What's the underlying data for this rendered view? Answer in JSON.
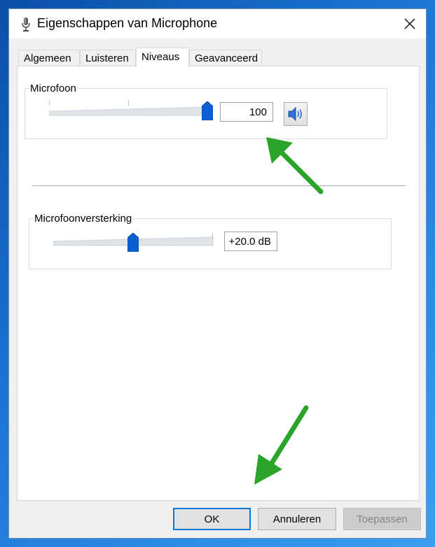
{
  "window": {
    "title": "Eigenschappen van Microphone",
    "title_icon": "microphone-icon",
    "close_icon": "close-icon"
  },
  "tabs": [
    {
      "label": "Algemeen",
      "active": false
    },
    {
      "label": "Luisteren",
      "active": false
    },
    {
      "label": "Niveaus",
      "active": true
    },
    {
      "label": "Geavanceerd",
      "active": false
    }
  ],
  "levels": {
    "microphone": {
      "label": "Microfoon",
      "value": "100",
      "level_fraction": 1.0,
      "mute_icon": "speaker-icon"
    },
    "boost": {
      "label": "Microfoonversterking",
      "value": "+20.0 dB",
      "level_fraction": 0.5
    }
  },
  "buttons": {
    "ok": "OK",
    "cancel": "Annuleren",
    "apply": "Toepassen"
  },
  "colors": {
    "accent": "#0a5fd1",
    "annotation_arrow": "#2aa52a",
    "desktop": "#1e78d6"
  }
}
